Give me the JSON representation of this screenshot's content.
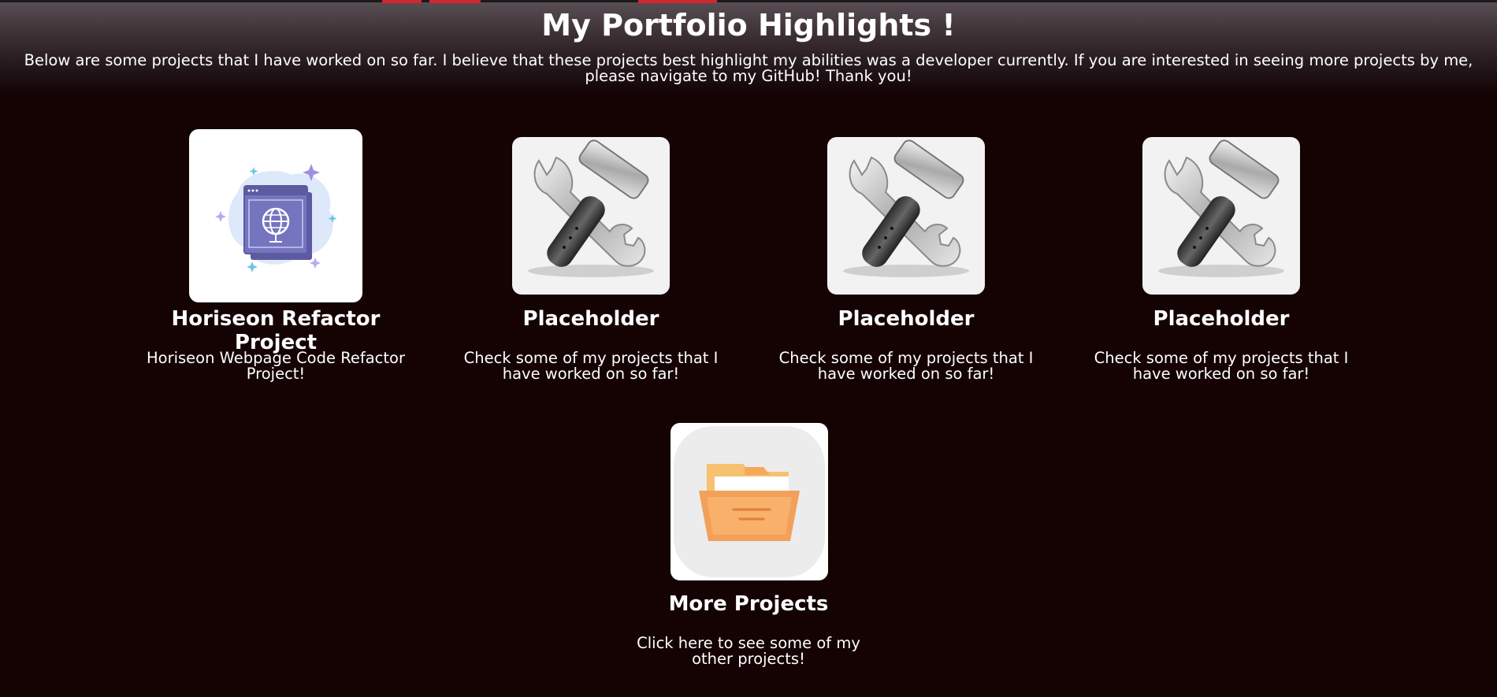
{
  "header": {
    "title": "My Portfolio Highlights !",
    "intro": "Below are some projects that I have worked on so far. I believe that these projects best highlight my abilities was a developer currently. If you are interested in seeing more projects by me, please navigate to my GitHub! Thank you!"
  },
  "projects": [
    {
      "name": "Horiseon Refactor Project",
      "description": "Horiseon Webpage Code Refactor Project!",
      "icon": "web-globe-illustration"
    },
    {
      "name": "Placeholder",
      "description": "Check some of my projects that I have worked on so far!",
      "icon": "wrench-hammer-tools"
    },
    {
      "name": "Placeholder",
      "description": "Check some of my projects that I have worked on so far!",
      "icon": "wrench-hammer-tools"
    },
    {
      "name": "Placeholder",
      "description": "Check some of my projects that I have worked on so far!",
      "icon": "wrench-hammer-tools"
    },
    {
      "name": "More Projects",
      "description": "Click here to see some of my other projects!",
      "icon": "folder-icon"
    }
  ],
  "colors": {
    "background": "#150304",
    "accent": "#d0282e",
    "text": "#ffffff"
  }
}
